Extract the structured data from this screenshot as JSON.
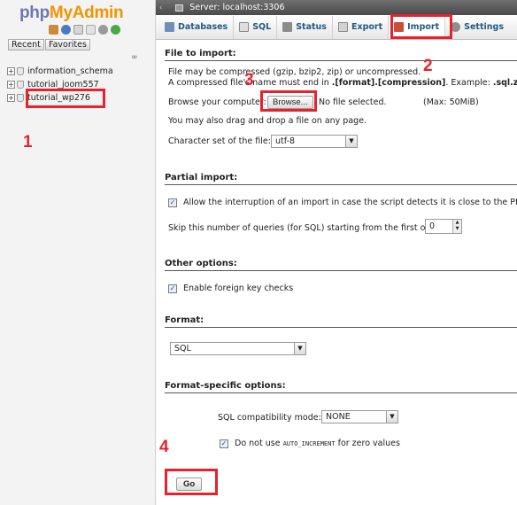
{
  "sidebar": {
    "logo_php": "php",
    "logo_myadmin": "MyAdmin",
    "recent_label": "Recent",
    "favorites_label": "Favorites",
    "databases": [
      {
        "name": "information_schema"
      },
      {
        "name": "tutorial_joom557"
      },
      {
        "name": "tutorial_wp276"
      }
    ]
  },
  "server_bar": {
    "title": "Server: localhost:3306"
  },
  "tabs": [
    {
      "label": "Databases",
      "icon": "databases-icon"
    },
    {
      "label": "SQL",
      "icon": "sql-icon"
    },
    {
      "label": "Status",
      "icon": "status-icon"
    },
    {
      "label": "Export",
      "icon": "export-icon"
    },
    {
      "label": "Import",
      "icon": "import-icon",
      "active": true
    },
    {
      "label": "Settings",
      "icon": "wrench-icon"
    }
  ],
  "file_import": {
    "title": "File to import:",
    "line1": "File may be compressed (gzip, bzip2, zip) or uncompressed.",
    "line2_prefix": "A compressed file's name must end in ",
    "line2_bold": ".[format].[compression]",
    "line2_suffix": ". Example: ",
    "line2_example": ".sql.zip",
    "browse_label": "Browse your computer:",
    "browse_button": "Browse...",
    "no_file": "No file selected.",
    "max_size": "(Max: 50MiB)",
    "drag_hint": "You may also drag and drop a file on any page.",
    "charset_label": "Character set of the file:",
    "charset_value": "utf-8"
  },
  "partial_import": {
    "title": "Partial import:",
    "allow_interrupt": "Allow the interruption of an import in case the script detects it is close to the PHP tim",
    "skip_label": "Skip this number of queries (for SQL) starting from the first one:",
    "skip_value": "0"
  },
  "other_options": {
    "title": "Other options:",
    "foreign_key": "Enable foreign key checks"
  },
  "format": {
    "title": "Format:",
    "value": "SQL"
  },
  "format_specific": {
    "title": "Format-specific options:",
    "compat_label": "SQL compatibility mode:",
    "compat_value": "NONE",
    "auto_inc_prefix": "Do not use ",
    "auto_inc_code": "AUTO_INCREMENT",
    "auto_inc_suffix": " for zero values"
  },
  "go_button": "Go",
  "annotations": {
    "n1": "1",
    "n2": "2",
    "n3": "3",
    "n4": "4"
  },
  "colors": {
    "annotation": "#e8212b",
    "link": "#235a81",
    "logo_php": "#6c78af",
    "logo_myadmin": "#f29400"
  }
}
